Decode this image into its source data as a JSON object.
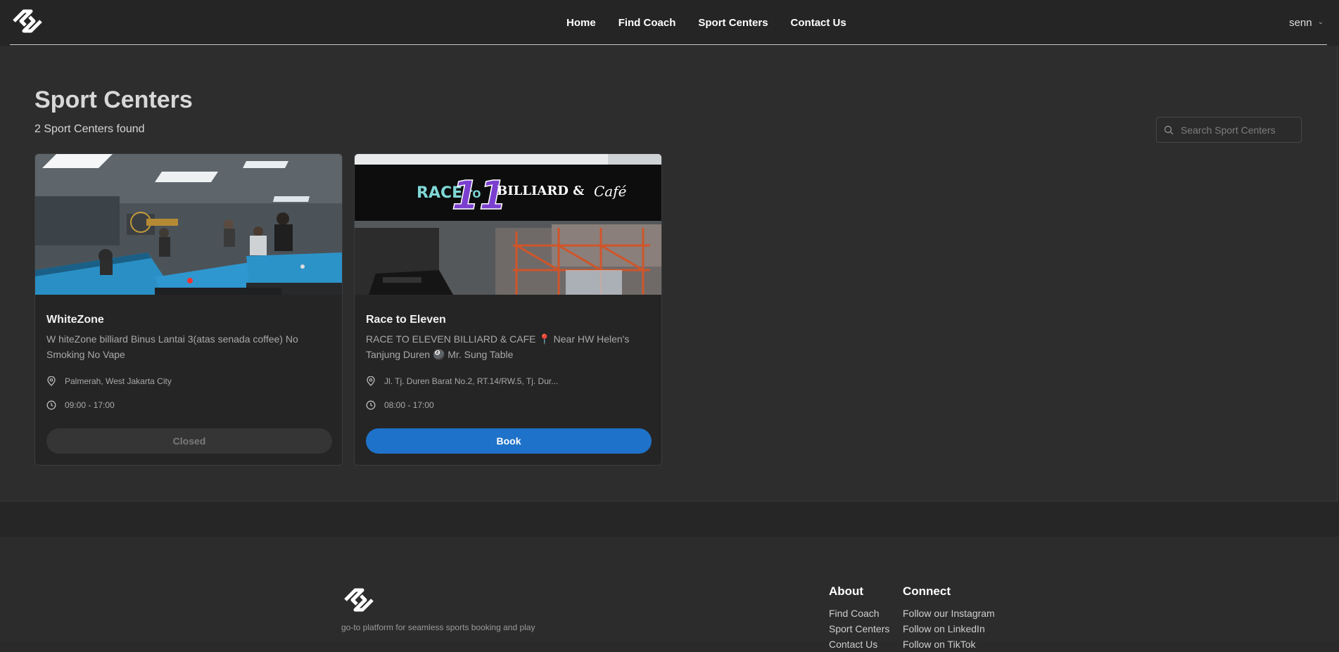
{
  "nav": {
    "links": [
      "Home",
      "Find Coach",
      "Sport Centers",
      "Contact Us"
    ],
    "user": "senn"
  },
  "page": {
    "title": "Sport Centers",
    "count": "2 Sport Centers found",
    "search_placeholder": "Search Sport Centers"
  },
  "cards": [
    {
      "name": "WhiteZone",
      "description": "W hiteZone billiard Binus Lantai 3(atas senada coffee) No Smoking No Vape",
      "location": "Palmerah, West Jakarta City",
      "hours": "09:00 - 17:00",
      "button": "Closed",
      "status": "closed"
    },
    {
      "name": "Race to Eleven",
      "description": "RACE TO ELEVEN BILLIARD & CAFE 📍 Near HW Helen's Tanjung Duren 🎱 Mr. Sung Table",
      "location": "Jl. Tj. Duren Barat No.2, RT.14/RW.5, Tj. Dur...",
      "hours": "08:00 - 17:00",
      "button": "Book",
      "status": "open",
      "sign": {
        "race": "RACE",
        "to": "TO",
        "eleven": "11",
        "title": "BILLIARD &",
        "cafe": "Café"
      }
    }
  ],
  "footer": {
    "tagline": "go-to platform for seamless sports booking and play",
    "about": {
      "heading": "About",
      "items": [
        "Find Coach",
        "Sport Centers",
        "Contact Us"
      ]
    },
    "connect": {
      "heading": "Connect",
      "items": [
        "Follow our Instagram",
        "Follow on LinkedIn",
        "Follow on TikTok"
      ]
    }
  },
  "colors": {
    "accent": "#1f72c9",
    "background": "#2d2d2d"
  }
}
